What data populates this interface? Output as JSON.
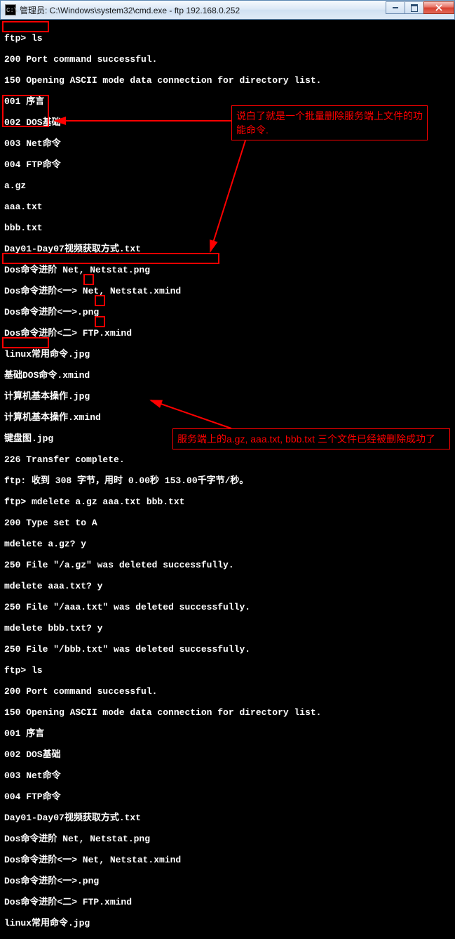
{
  "titlebar": {
    "icon_label": "C:\\",
    "title": "管理员: C:\\Windows\\system32\\cmd.exe - ftp  192.168.0.252"
  },
  "window_buttons": {
    "min": "minimize",
    "max": "maximize",
    "close": "close"
  },
  "terminal_lines": [
    "ftp> ls",
    "200 Port command successful.",
    "150 Opening ASCII mode data connection for directory list.",
    "001 序言",
    "002 DOS基础",
    "003 Net命令",
    "004 FTP命令",
    "a.gz",
    "aaa.txt",
    "bbb.txt",
    "Day01-Day07视频获取方式.txt",
    "Dos命令进阶 Net, Netstat.png",
    "Dos命令进阶<一> Net, Netstat.xmind",
    "Dos命令进阶<一>.png",
    "Dos命令进阶<二> FTP.xmind",
    "linux常用命令.jpg",
    "基础DOS命令.xmind",
    "计算机基本操作.jpg",
    "计算机基本操作.xmind",
    "键盘图.jpg",
    "226 Transfer complete.",
    "ftp: 收到 308 字节，用时 0.00秒 153.00千字节/秒。",
    "ftp> mdelete a.gz aaa.txt bbb.txt",
    "200 Type set to A",
    "mdelete a.gz? y",
    "250 File \"/a.gz\" was deleted successfully.",
    "mdelete aaa.txt? y",
    "250 File \"/aaa.txt\" was deleted successfully.",
    "mdelete bbb.txt? y",
    "250 File \"/bbb.txt\" was deleted successfully.",
    "ftp> ls",
    "200 Port command successful.",
    "150 Opening ASCII mode data connection for directory list.",
    "001 序言",
    "002 DOS基础",
    "003 Net命令",
    "004 FTP命令",
    "Day01-Day07视频获取方式.txt",
    "Dos命令进阶 Net, Netstat.png",
    "Dos命令进阶<一> Net, Netstat.xmind",
    "Dos命令进阶<一>.png",
    "Dos命令进阶<二> FTP.xmind",
    "linux常用命令.jpg"
  ],
  "annotations": {
    "callout1": "说白了就是一个批量删除服务端上文件的功能命令.",
    "callout2": "服务端上的a.gz, aaa.txt, bbb.txt 三个文件已经被删除成功了"
  },
  "highlight_boxes": {
    "box_ls1": "ftp> ls (first)",
    "box_files": "a.gz / aaa.txt / bbb.txt listing",
    "box_mdelete": "ftp> mdelete a.gz aaa.txt bbb.txt",
    "box_y1": "y (a.gz confirm)",
    "box_y2": "y (aaa.txt confirm)",
    "box_y3": "y (bbb.txt confirm)",
    "box_ls2": "ftp> ls (second)"
  },
  "colors": {
    "terminal_bg": "#000000",
    "terminal_fg": "#ffffff",
    "annotation": "#ff0000",
    "titlebar_start": "#f5f9fd",
    "titlebar_end": "#cfe0f2",
    "close_btn": "#d7402f"
  }
}
